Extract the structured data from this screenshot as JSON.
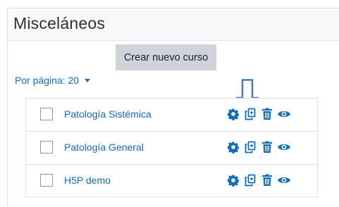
{
  "category": {
    "title": "Misceláneos"
  },
  "toolbar": {
    "create_course_label": "Crear nuevo curso"
  },
  "pagination": {
    "per_page_label": "Por página: 20"
  },
  "courses": [
    {
      "name": "Patología Sistémica"
    },
    {
      "name": "Patología General"
    },
    {
      "name": "H5P demo"
    }
  ],
  "row_actions": [
    "gear-icon",
    "copy-icon",
    "trash-icon",
    "eye-icon"
  ],
  "colors": {
    "link": "#0f6cbf",
    "button_bg": "#ced4da",
    "header_bg": "#f8f9fa",
    "annotation_arrow": "#4a7ab5"
  }
}
